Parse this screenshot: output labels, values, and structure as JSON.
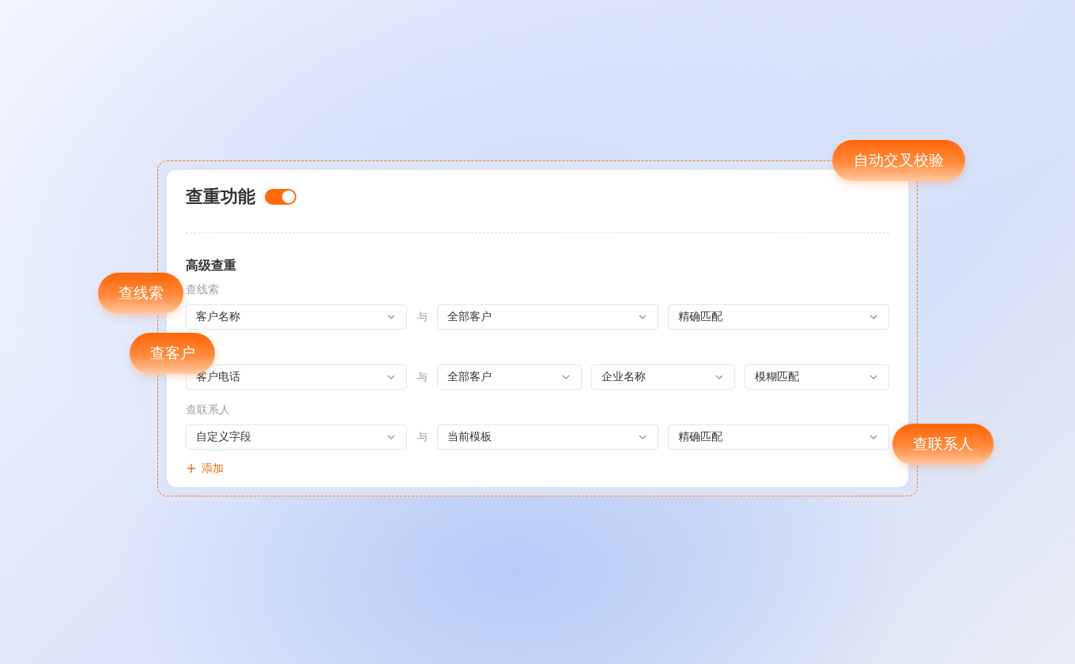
{
  "title": "查重功能",
  "toggle": {
    "on": true
  },
  "section_title": "高级查重",
  "groups": [
    {
      "label": "查线索",
      "connector": "与",
      "fields": [
        {
          "value": "客户名称"
        },
        {
          "value": "全部客户"
        },
        {
          "value": "精确匹配"
        }
      ]
    },
    {
      "connector": "与",
      "fields": [
        {
          "value": "客户电话"
        },
        {
          "value": "全部客户"
        },
        {
          "value": "企业名称"
        },
        {
          "value": "模糊匹配"
        }
      ]
    },
    {
      "label": "查联系人",
      "connector": "与",
      "fields": [
        {
          "value": "自定义字段"
        },
        {
          "value": "当前模板"
        },
        {
          "value": "精确匹配"
        }
      ]
    }
  ],
  "add_button": {
    "icon": "+",
    "label": "添加"
  },
  "badges": [
    {
      "text": "自动交叉校验"
    },
    {
      "text": "查线索"
    },
    {
      "text": "查客户"
    },
    {
      "text": "查联系人"
    }
  ]
}
